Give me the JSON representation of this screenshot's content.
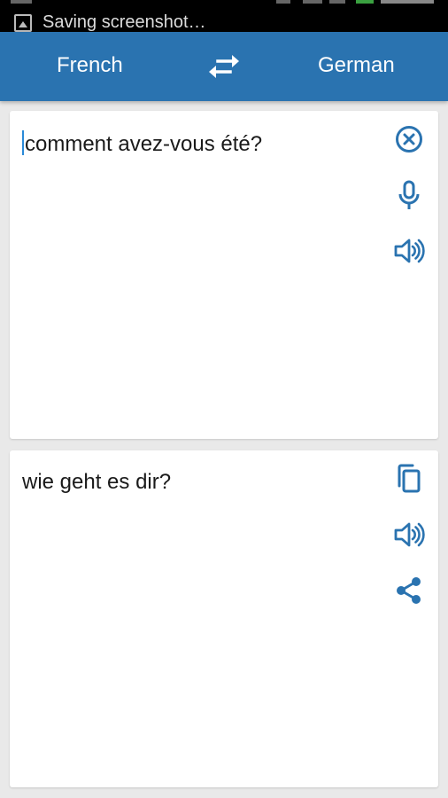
{
  "status_bar": {
    "notification_text": "Saving screenshot…"
  },
  "toolbar": {
    "source_language": "French",
    "target_language": "German",
    "swap_icon": "swap-arrows-icon",
    "accent_color": "#2a73b0"
  },
  "source_panel": {
    "text": "comment avez-vous été?",
    "icons": [
      "clear-icon",
      "microphone-icon",
      "speaker-icon"
    ]
  },
  "target_panel": {
    "text": "wie geht es dir?",
    "icons": [
      "copy-icon",
      "speaker-icon",
      "share-icon"
    ]
  }
}
